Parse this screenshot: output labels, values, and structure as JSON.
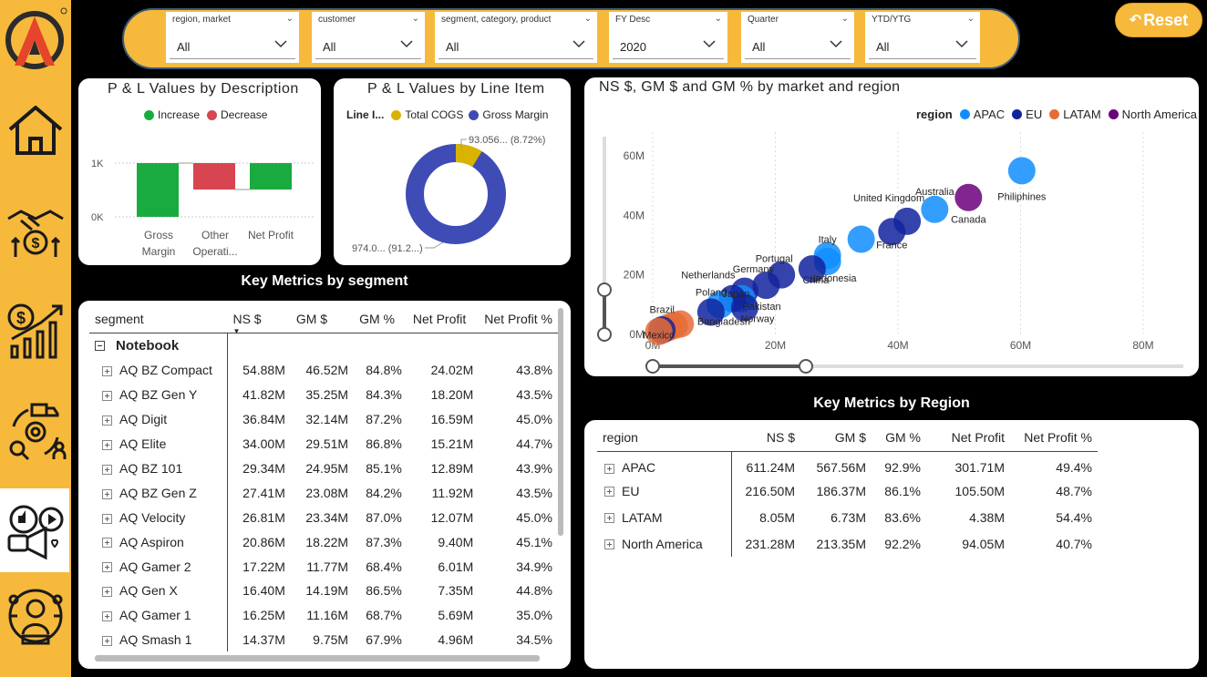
{
  "nav": {
    "items": [
      {
        "icon": "home-icon"
      },
      {
        "icon": "handshake-money-icon"
      },
      {
        "icon": "finance-growth-icon"
      },
      {
        "icon": "supply-chain-icon"
      },
      {
        "icon": "marketing-icon",
        "active": true
      },
      {
        "icon": "executive-icon"
      }
    ]
  },
  "filters": [
    {
      "title": "region, market",
      "value": "All"
    },
    {
      "title": "customer",
      "value": "All"
    },
    {
      "title": "segment, category, product",
      "value": "All"
    },
    {
      "title": "FY Desc",
      "value": "2020"
    },
    {
      "title": "Quarter",
      "value": "All"
    },
    {
      "title": "YTD/YTG",
      "value": "All"
    }
  ],
  "reset_label": "Reset",
  "pl_desc": {
    "title": "P & L Values by Description",
    "legend": [
      {
        "label": "Increase",
        "color": "#1AAB40"
      },
      {
        "label": "Decrease",
        "color": "#D64550"
      }
    ],
    "ticks": [
      "1K",
      "0K"
    ],
    "bar_labels": [
      [
        "Gross",
        "Margin"
      ],
      [
        "Other",
        "Operati..."
      ],
      [
        "Net Profit",
        ""
      ]
    ]
  },
  "pl_line": {
    "title": "P & L Values by Line Item",
    "legend_title": "Line I...",
    "legend": [
      {
        "label": "Total COGS",
        "color": "#D9B300"
      },
      {
        "label": "Gross Margin",
        "color": "#3F4CB5"
      }
    ],
    "label_top": "93.056... (8.72%)",
    "label_bottom": "974.0... (91.2...)"
  },
  "scatter_title": "NS $, GM $ and GM % by market and region",
  "chart_data": {
    "type": "scatter",
    "title": "NS $, GM $ and GM % by market and region",
    "legend_title": "region",
    "series": [
      {
        "name": "APAC",
        "color": "#118DFF"
      },
      {
        "name": "EU",
        "color": "#12239E"
      },
      {
        "name": "LATAM",
        "color": "#E66C37"
      },
      {
        "name": "North America",
        "color": "#6B007B"
      }
    ],
    "x_ticks": [
      "0M",
      "20M",
      "40M",
      "60M",
      "80M"
    ],
    "y_ticks": [
      "60M",
      "40M",
      "20M",
      "0M"
    ],
    "xlim": [
      0,
      80
    ],
    "ylim": [
      0,
      60
    ],
    "points": [
      {
        "label": "Philiphines",
        "x": 60.2,
        "y": 55,
        "region": "APAC"
      },
      {
        "label": "Canada",
        "x": 51.5,
        "y": 46,
        "region": "North America"
      },
      {
        "label": "Australia",
        "x": 46,
        "y": 42,
        "region": "APAC"
      },
      {
        "label": "United Kingdom",
        "x": 41.5,
        "y": 38,
        "region": "EU"
      },
      {
        "label": "France",
        "x": 39,
        "y": 34.5,
        "region": "EU"
      },
      {
        "label": "",
        "x": 34,
        "y": 32,
        "region": "APAC"
      },
      {
        "label": "Italy",
        "x": 28.5,
        "y": 26.5,
        "region": "APAC"
      },
      {
        "label": "Indonesia",
        "x": 28.5,
        "y": 24.5,
        "region": "APAC"
      },
      {
        "label": "China",
        "x": 26,
        "y": 22,
        "region": "EU"
      },
      {
        "label": "Portugal",
        "x": 21,
        "y": 20,
        "region": "EU"
      },
      {
        "label": "Germany",
        "x": 18.5,
        "y": 16.5,
        "region": "EU"
      },
      {
        "label": "Netherlands",
        "x": 15,
        "y": 14.5,
        "region": "EU"
      },
      {
        "label": "Pakistan",
        "x": 14.5,
        "y": 12,
        "region": "APAC"
      },
      {
        "label": "Japan",
        "x": 13,
        "y": 12,
        "region": "EU"
      },
      {
        "label": "Poland",
        "x": 11,
        "y": 10,
        "region": "APAC"
      },
      {
        "label": "Norway",
        "x": 15,
        "y": 9,
        "region": "EU"
      },
      {
        "label": "Bangladesh",
        "x": 9.5,
        "y": 7.5,
        "region": "EU"
      },
      {
        "label": "Brazil",
        "x": 4.5,
        "y": 3.5,
        "region": "LATAM"
      },
      {
        "label": "",
        "x": 3.5,
        "y": 3.0,
        "region": "LATAM"
      },
      {
        "label": "",
        "x": 2.5,
        "y": 2.3,
        "region": "LATAM"
      },
      {
        "label": "",
        "x": 1.5,
        "y": 1.5,
        "region": "EU"
      },
      {
        "label": "Mexico",
        "x": 1.0,
        "y": 1.0,
        "region": "LATAM"
      }
    ]
  },
  "seg_title": "Key Metrics by segment",
  "seg_table": {
    "headers": [
      "segment",
      "NS $",
      "GM $",
      "GM %",
      "Net Profit",
      "Net Profit %"
    ],
    "group": "Notebook",
    "rows": [
      [
        "AQ BZ Compact",
        "54.88M",
        "46.52M",
        "84.8%",
        "24.02M",
        "43.8%"
      ],
      [
        "AQ BZ Gen Y",
        "41.82M",
        "35.25M",
        "84.3%",
        "18.20M",
        "43.5%"
      ],
      [
        "AQ Digit",
        "36.84M",
        "32.14M",
        "87.2%",
        "16.59M",
        "45.0%"
      ],
      [
        "AQ Elite",
        "34.00M",
        "29.51M",
        "86.8%",
        "15.21M",
        "44.7%"
      ],
      [
        "AQ BZ 101",
        "29.34M",
        "24.95M",
        "85.1%",
        "12.89M",
        "43.9%"
      ],
      [
        "AQ BZ Gen Z",
        "27.41M",
        "23.08M",
        "84.2%",
        "11.92M",
        "43.5%"
      ],
      [
        "AQ Velocity",
        "26.81M",
        "23.34M",
        "87.0%",
        "12.07M",
        "45.0%"
      ],
      [
        "AQ Aspiron",
        "20.86M",
        "18.22M",
        "87.3%",
        "9.40M",
        "45.1%"
      ],
      [
        "AQ Gamer 2",
        "17.22M",
        "11.77M",
        "68.4%",
        "6.01M",
        "34.9%"
      ],
      [
        "AQ Gen X",
        "16.40M",
        "14.19M",
        "86.5%",
        "7.35M",
        "44.8%"
      ],
      [
        "AQ Gamer 1",
        "16.25M",
        "11.16M",
        "68.7%",
        "5.69M",
        "35.0%"
      ],
      [
        "AQ Smash 1",
        "14.37M",
        "9.75M",
        "67.9%",
        "4.96M",
        "34.5%"
      ]
    ]
  },
  "region_title": "Key Metrics by Region",
  "region_table": {
    "headers": [
      "region",
      "NS $",
      "GM $",
      "GM %",
      "Net Profit",
      "Net Profit %"
    ],
    "rows": [
      [
        "APAC",
        "611.24M",
        "567.56M",
        "92.9%",
        "301.71M",
        "49.4%"
      ],
      [
        "EU",
        "216.50M",
        "186.37M",
        "86.1%",
        "105.50M",
        "48.7%"
      ],
      [
        "LATAM",
        "8.05M",
        "6.73M",
        "83.6%",
        "4.38M",
        "54.4%"
      ],
      [
        "North America",
        "231.28M",
        "213.35M",
        "92.2%",
        "94.05M",
        "40.7%"
      ]
    ]
  }
}
